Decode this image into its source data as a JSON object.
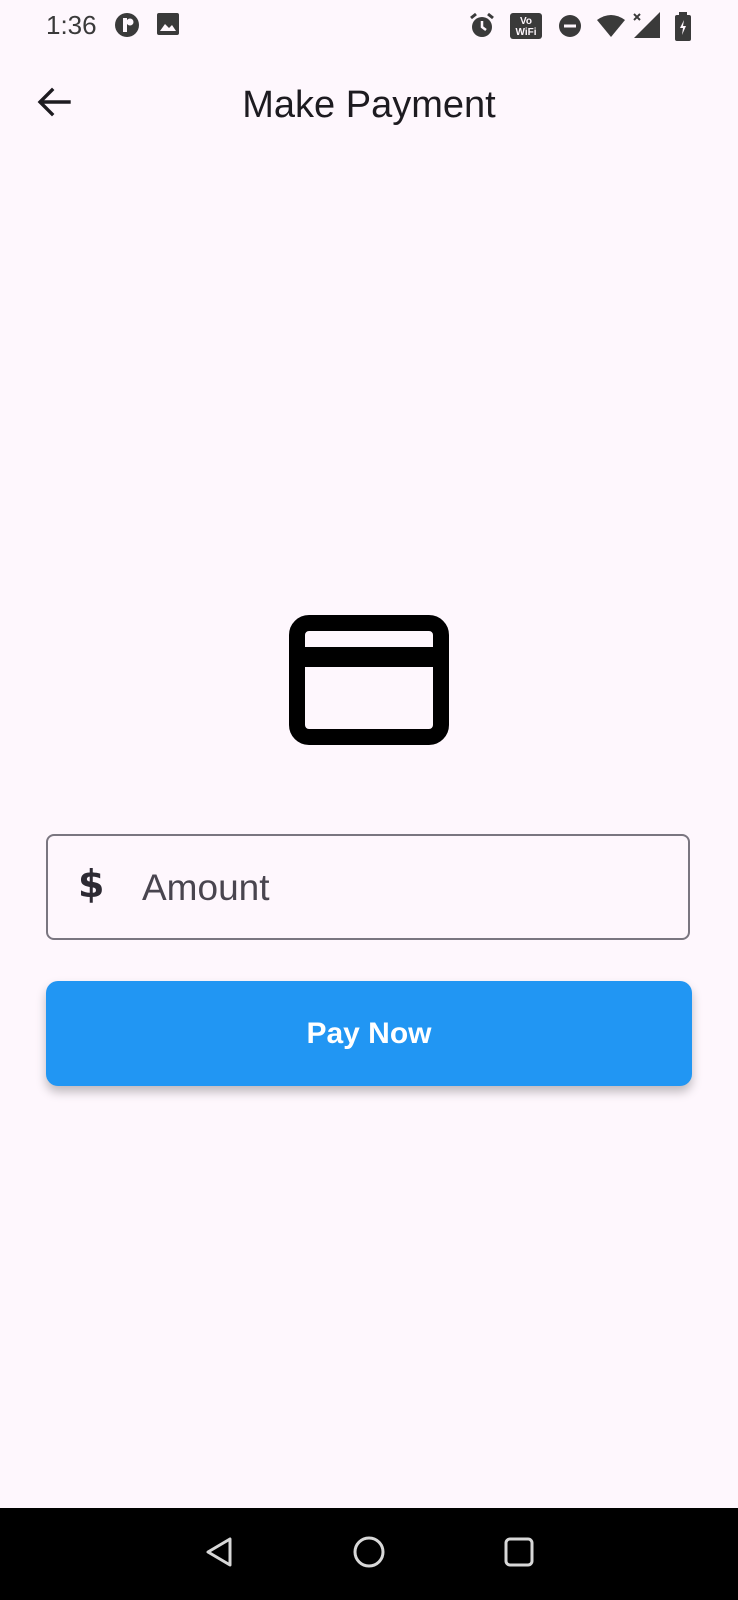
{
  "status_bar": {
    "time": "1:36",
    "icons": [
      "notification-app-icon",
      "image-icon",
      "alarm-icon",
      "vowifi-icon",
      "do-not-disturb-icon",
      "wifi-icon",
      "signal-icon",
      "battery-charging-icon"
    ],
    "vowifi_label_top": "Vo",
    "vowifi_label_bottom": "WiFi"
  },
  "app_bar": {
    "title": "Make Payment",
    "back_icon": "arrow-back-icon"
  },
  "main": {
    "card_icon": "credit-card-icon",
    "amount_field": {
      "prefix_icon": "dollar-icon",
      "prefix_symbol": "$",
      "placeholder": "Amount",
      "value": ""
    },
    "pay_button": {
      "label": "Pay Now",
      "color": "#2196f3"
    }
  },
  "nav_bar": {
    "buttons": [
      "back-triangle-icon",
      "home-circle-icon",
      "recents-square-icon"
    ]
  },
  "colors": {
    "background": "#fef7fd",
    "accent": "#2196f3",
    "text": "#1d1b20"
  }
}
